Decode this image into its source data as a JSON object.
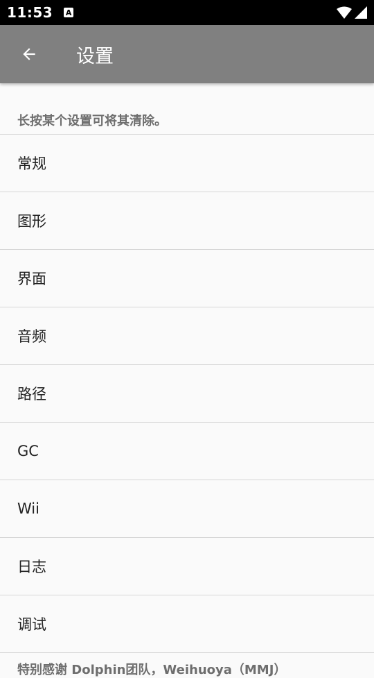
{
  "status_bar": {
    "time": "11:53",
    "notification_icon": "A",
    "wifi": "wifi-icon",
    "signal": "signal-icon"
  },
  "app_bar": {
    "back_icon": "arrow-back-icon",
    "title": "设置",
    "color": "#808080"
  },
  "hint": "长按某个设置可将其清除。",
  "items": [
    {
      "label": "常规"
    },
    {
      "label": "图形"
    },
    {
      "label": "界面"
    },
    {
      "label": "音频"
    },
    {
      "label": "路径"
    },
    {
      "label": "GC"
    },
    {
      "label": "Wii"
    },
    {
      "label": "日志"
    },
    {
      "label": "调试"
    }
  ],
  "footer": "特别感谢 Dolphin团队，Weihuoya（MMJ）"
}
